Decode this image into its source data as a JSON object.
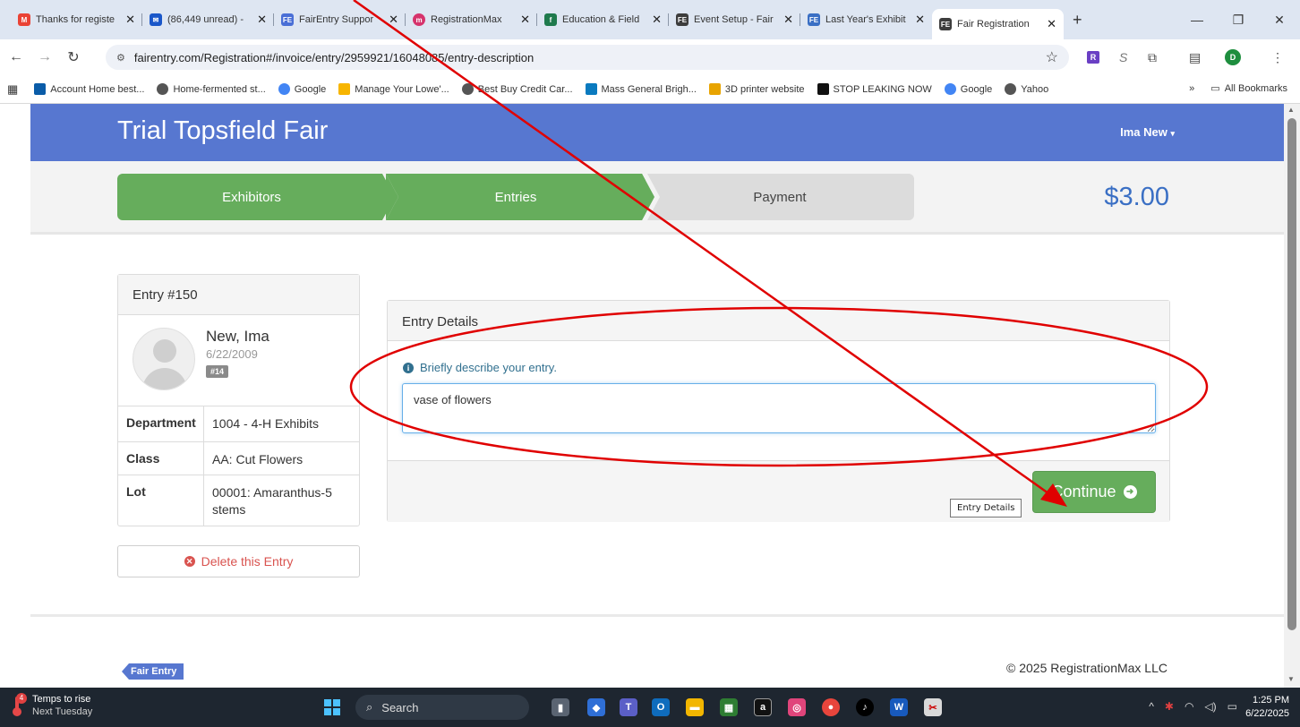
{
  "browser": {
    "tabs": [
      {
        "title": "Thanks for registe",
        "fav_color": "#ea4335",
        "fav_text": "M"
      },
      {
        "title": "(86,449 unread) -",
        "fav_color": "#1a57c9",
        "fav_text": "✉"
      },
      {
        "title": "FairEntry Suppor",
        "fav_color": "#4a6fd6",
        "fav_text": "FE"
      },
      {
        "title": "RegistrationMax",
        "fav_color": "#d6336c",
        "fav_text": "m"
      },
      {
        "title": "Education & Field",
        "fav_color": "#1f7a4d",
        "fav_text": "f"
      },
      {
        "title": "Event Setup - Fair",
        "fav_color": "#3d3d3d",
        "fav_text": "FE"
      },
      {
        "title": "Last Year's Exhibit",
        "fav_color": "#3a6fc4",
        "fav_text": "FE"
      },
      {
        "title": "Fair Registration",
        "fav_color": "#3d3d3d",
        "fav_text": "FE"
      }
    ],
    "url": "fairentry.com/Registration#/invoice/entry/2959921/16048085/entry-description",
    "bookmarks": [
      {
        "label": "Account Home best...",
        "color": "#0a5ca8"
      },
      {
        "label": "Home-fermented st...",
        "color": "#555555"
      },
      {
        "label": "Google",
        "color": "#4285f4"
      },
      {
        "label": "Manage Your Lowe'...",
        "color": "#f7b500"
      },
      {
        "label": "Best Buy Credit Car...",
        "color": "#555555"
      },
      {
        "label": "Mass General Brigh...",
        "color": "#0a7abf"
      },
      {
        "label": "3D printer website",
        "color": "#e8a400"
      },
      {
        "label": "STOP LEAKING NOW",
        "color": "#111111"
      },
      {
        "label": "Google",
        "color": "#4285f4"
      },
      {
        "label": "Yahoo",
        "color": "#555555"
      }
    ],
    "all_bookmarks": "All Bookmarks",
    "profile_initial": "D",
    "ext_initial": "R"
  },
  "app": {
    "brand": "Trial Topsfield Fair",
    "user": "Ima New",
    "steps": [
      "Exhibitors",
      "Entries",
      "Payment"
    ],
    "total": "$3.00",
    "entry": {
      "title": "Entry #150",
      "name": "New, Ima",
      "dob": "6/22/2009",
      "badge": "#14",
      "rows": [
        {
          "label": "Department",
          "value": "1004 - 4-H Exhibits"
        },
        {
          "label": "Class",
          "value": "AA: Cut Flowers"
        },
        {
          "label": "Lot",
          "value": "00001: Amaranthus-5 stems"
        }
      ],
      "delete_label": "Delete this Entry"
    },
    "details": {
      "heading": "Entry Details",
      "hint": "Briefly describe your entry.",
      "description": "vase of flowers",
      "tooltip": "Entry Details",
      "continue_label": "Continue"
    },
    "footer": {
      "logo": "Fair Entry",
      "copyright": "© 2025 RegistrationMax LLC"
    }
  },
  "taskbar": {
    "weather_line1": "Temps to rise",
    "weather_line2": "Next Tuesday",
    "weather_badge": "4",
    "search_placeholder": "Search",
    "time": "1:25 PM",
    "date": "6/22/2025"
  },
  "colors": {
    "navbar": "#5777d0",
    "step_done": "#66ad5c",
    "step_pending": "#dcdcdc",
    "total": "#3a6fc4",
    "danger": "#d9534f",
    "annotation": "#e00000"
  }
}
